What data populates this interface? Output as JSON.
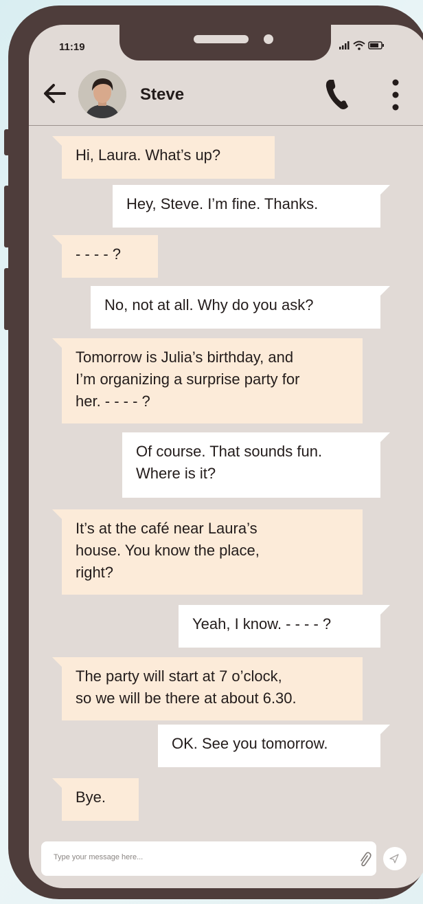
{
  "status_bar": {
    "time": "11:19"
  },
  "header": {
    "contact_name": "Steve"
  },
  "messages": [
    {
      "side": "in",
      "text": "Hi, Laura. What’s up?"
    },
    {
      "side": "out",
      "text": "Hey, Steve. I’m fine. Thanks."
    },
    {
      "side": "in",
      "text": "- - - - ?"
    },
    {
      "side": "out",
      "text": "No, not at all. Why do you ask?"
    },
    {
      "side": "in",
      "lines": [
        "Tomorrow is Julia’s birthday, and",
        "I’m organizing a surprise party for",
        "her. - - - - ?"
      ]
    },
    {
      "side": "out",
      "lines": [
        "Of course. That sounds fun.",
        "Where is it?"
      ]
    },
    {
      "side": "in",
      "lines": [
        "It’s at the café near Laura’s",
        "house. You know the place,",
        "right?"
      ]
    },
    {
      "side": "out",
      "text": "Yeah, I know. - - - - ?"
    },
    {
      "side": "in",
      "lines": [
        "The party will start at 7 o’clock,",
        "so we will be there at about 6.30."
      ]
    },
    {
      "side": "out",
      "text": "OK. See you tomorrow."
    },
    {
      "side": "in",
      "text": "Bye."
    }
  ],
  "composer": {
    "placeholder": "Type your message here..."
  },
  "colors": {
    "frame": "#4e3d3b",
    "screen": "#e1dad6",
    "incoming_bubble": "#fcebd9",
    "outgoing_bubble": "#ffffff",
    "text": "#231c1b"
  },
  "icons": [
    "back-arrow-icon",
    "phone-icon",
    "more-vertical-icon",
    "signal-icon",
    "wifi-icon",
    "battery-icon",
    "paperclip-icon",
    "send-icon"
  ]
}
